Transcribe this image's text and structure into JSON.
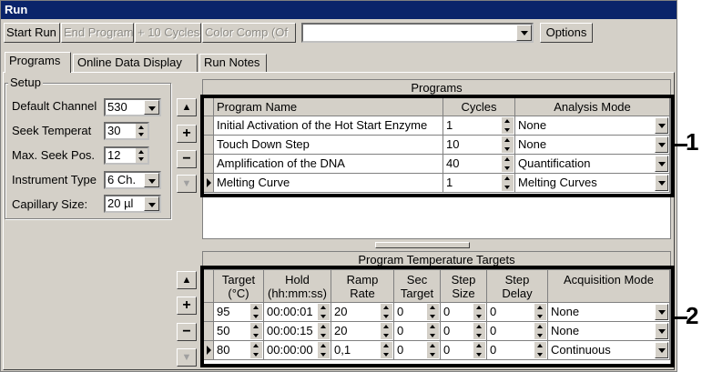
{
  "window": {
    "title": "Run"
  },
  "toolbar": {
    "start_run": "Start Run",
    "end_program": "End Program",
    "plus_10_cycles": "+ 10 Cycles",
    "color_comp": "Color Comp (Of",
    "program_select_value": "",
    "options": "Options"
  },
  "tabs": [
    {
      "label": "Programs",
      "active": true
    },
    {
      "label": "Online Data Display",
      "active": false
    },
    {
      "label": "Run Notes",
      "active": false
    }
  ],
  "setup": {
    "title": "Setup",
    "fields": [
      {
        "label": "Default Channel",
        "value": "530",
        "control": "dropdown"
      },
      {
        "label": "Seek Temperat",
        "value": "30",
        "control": "spin"
      },
      {
        "label": "Max. Seek Pos.",
        "value": "12",
        "control": "spin"
      },
      {
        "label": "Instrument Type",
        "value": "6 Ch.",
        "control": "dropdown"
      },
      {
        "label": "Capillary Size:",
        "value": "20 µl",
        "control": "dropdown"
      }
    ]
  },
  "side_buttons": {
    "up": "▲",
    "add": "+",
    "remove": "−",
    "down": "▼"
  },
  "programs": {
    "title": "Programs",
    "columns": [
      "Program Name",
      "Cycles",
      "Analysis Mode"
    ],
    "rows": [
      {
        "name": "Initial Activation of the Hot Start Enzyme",
        "cycles": "1",
        "mode": "None",
        "current": false
      },
      {
        "name": "Touch Down Step",
        "cycles": "10",
        "mode": "None",
        "current": false
      },
      {
        "name": "Amplification of the DNA",
        "cycles": "40",
        "mode": "Quantification",
        "current": false
      },
      {
        "name": "Melting Curve",
        "cycles": "1",
        "mode": "Melting Curves",
        "current": true
      }
    ]
  },
  "targets": {
    "title": "Program Temperature Targets",
    "columns": [
      {
        "l1": "Target",
        "l2": "(°C)"
      },
      {
        "l1": "Hold",
        "l2": "(hh:mm:ss)"
      },
      {
        "l1": "Ramp",
        "l2": "Rate"
      },
      {
        "l1": "Sec",
        "l2": "Target"
      },
      {
        "l1": "Step",
        "l2": "Size"
      },
      {
        "l1": "Step",
        "l2": "Delay"
      },
      {
        "l1": "Acquisition Mode",
        "l2": ""
      }
    ],
    "rows": [
      {
        "cells": [
          "95",
          "00:00:01",
          "20",
          "0",
          "0",
          "0",
          "None"
        ],
        "current": false
      },
      {
        "cells": [
          "50",
          "00:00:15",
          "20",
          "0",
          "0",
          "0",
          "None"
        ],
        "current": false
      },
      {
        "cells": [
          "80",
          "00:00:00",
          "0,1",
          "0",
          "0",
          "0",
          "Continuous"
        ],
        "current": true
      }
    ]
  },
  "callouts": {
    "one": "1",
    "two": "2"
  }
}
